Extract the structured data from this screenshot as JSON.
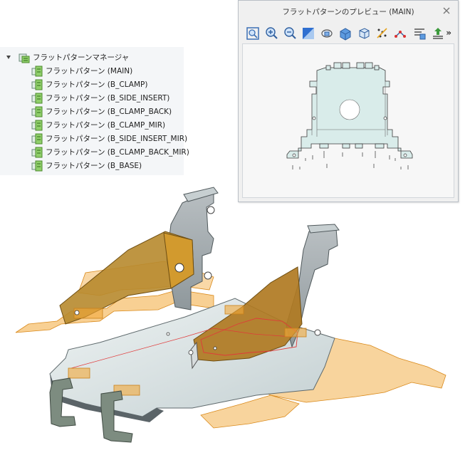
{
  "tree": {
    "root": "フラットパターンマネージャ",
    "items": [
      "フラットパターン (MAIN)",
      "フラットパターン (B_CLAMP)",
      "フラットパターン (B_SIDE_INSERT)",
      "フラットパターン (B_CLAMP_BACK)",
      "フラットパターン (B_CLAMP_MIR)",
      "フラットパターン (B_SIDE_INSERT_MIR)",
      "フラットパターン (B_CLAMP_BACK_MIR)",
      "フラットパターン (B_BASE)"
    ]
  },
  "preview": {
    "title": "フラットパターンのプレビュー (MAIN)",
    "more": "»",
    "toolbar": [
      "zoom-to-fit-icon",
      "zoom-in-icon",
      "zoom-out-icon",
      "display-style-icon",
      "view-orientation-icon",
      "section-view-icon",
      "standard-views-icon",
      "bend-lines-icon",
      "sketch-icon",
      "annotation-icon",
      "export-icon"
    ]
  },
  "colors": {
    "tree_bg": "#f4f6f8",
    "sheet_metal": "#c9d6d8",
    "flat_pattern": "#f2a93b",
    "flange_dark": "#b57d1d",
    "clamp": "#7d8c80"
  }
}
